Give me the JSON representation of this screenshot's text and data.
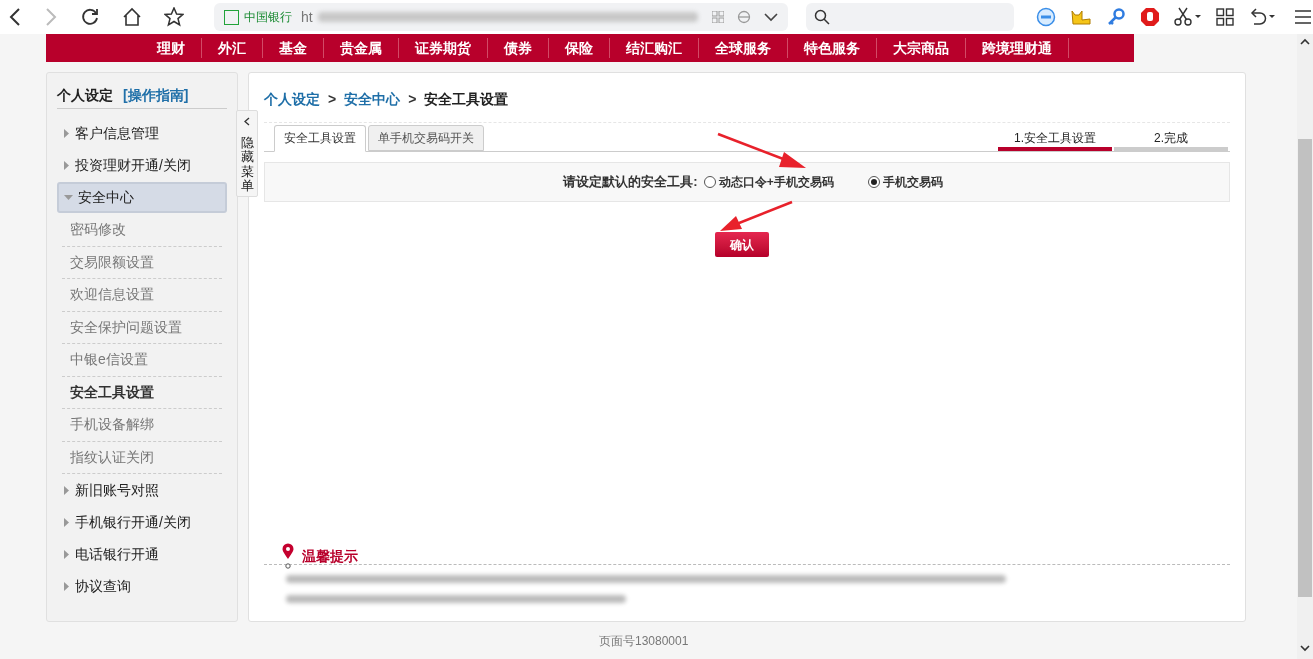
{
  "browser": {
    "site_label": "中国银行",
    "url": "ht"
  },
  "nav_menu": [
    "理财",
    "外汇",
    "基金",
    "贵金属",
    "证券期货",
    "债券",
    "保险",
    "结汇购汇",
    "全球服务",
    "特色服务",
    "大宗商品",
    "跨境理财通"
  ],
  "sidebar": {
    "title": "个人设定",
    "guide_link": "[操作指南]",
    "items": [
      {
        "label": "客户信息管理",
        "expanded": false
      },
      {
        "label": "投资理财开通/关闭",
        "expanded": false
      },
      {
        "label": "安全中心",
        "expanded": true,
        "children": [
          {
            "label": "密码修改",
            "selected": false
          },
          {
            "label": "交易限额设置",
            "selected": false
          },
          {
            "label": "欢迎信息设置",
            "selected": false
          },
          {
            "label": "安全保护问题设置",
            "selected": false
          },
          {
            "label": "中银e信设置",
            "selected": false
          },
          {
            "label": "安全工具设置",
            "selected": true
          },
          {
            "label": "手机设备解绑",
            "selected": false
          },
          {
            "label": "指纹认证关闭",
            "selected": false
          }
        ]
      },
      {
        "label": "新旧账号对照",
        "expanded": false
      },
      {
        "label": "手机银行开通/关闭",
        "expanded": false
      },
      {
        "label": "电话银行开通",
        "expanded": false
      },
      {
        "label": "协议查询",
        "expanded": false
      }
    ]
  },
  "hide_menu": {
    "label": "隐藏菜单"
  },
  "breadcrumb": [
    {
      "text": "个人设定",
      "kind": "link"
    },
    {
      "text": ">",
      "kind": "separator"
    },
    {
      "text": "安全中心",
      "kind": "link"
    },
    {
      "text": ">",
      "kind": "separator"
    },
    {
      "text": "安全工具设置",
      "kind": "current"
    }
  ],
  "tabs": [
    {
      "label": "安全工具设置",
      "selected": true
    },
    {
      "label": "单手机交易码开关",
      "selected": false
    }
  ],
  "steps": [
    {
      "label": "1.安全工具设置",
      "selected": true
    },
    {
      "label": "2.完成",
      "selected": false
    }
  ],
  "form": {
    "label": "请设定默认的安全工具:",
    "options": [
      {
        "label": "动态口令+手机交易码",
        "selected": false
      },
      {
        "label": "手机交易码",
        "selected": true
      }
    ]
  },
  "confirm_button": "确认",
  "tips": {
    "title": "温馨提示"
  },
  "footer": "页面号13080001"
}
